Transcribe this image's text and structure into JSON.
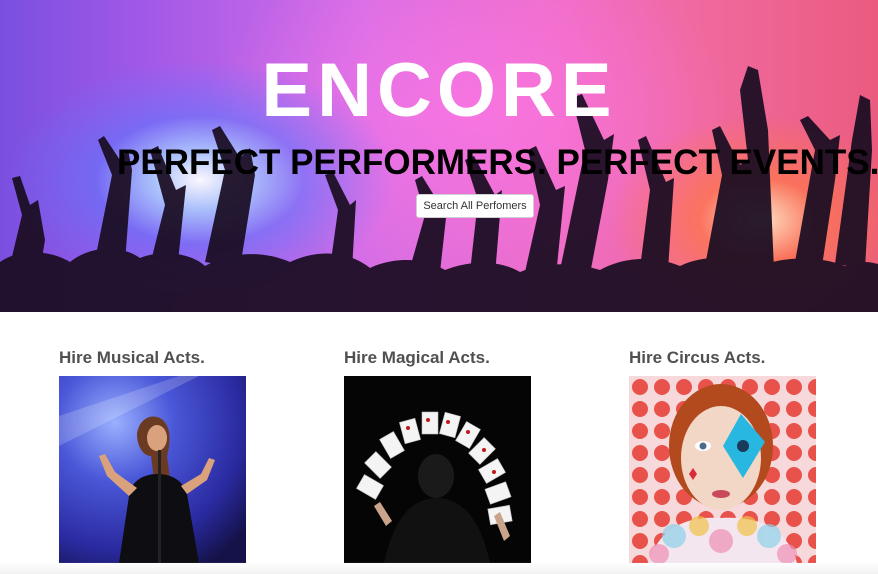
{
  "hero": {
    "title": "ENCORE",
    "tagline": "PERFECT PERFORMERS. PERFECT EVENTS.",
    "button_label": "Search All Perfomers"
  },
  "acts": [
    {
      "title": "Hire Musical Acts.",
      "image": "singer-on-stage-photo"
    },
    {
      "title": "Hire Magical Acts.",
      "image": "magician-card-fan-photo"
    },
    {
      "title": "Hire Circus Acts.",
      "image": "harlequin-face-paint-photo"
    }
  ],
  "colors": {
    "hero_purple": "#7a4fe0",
    "hero_pink": "#ee6dc9",
    "heading_gray": "#505050"
  }
}
